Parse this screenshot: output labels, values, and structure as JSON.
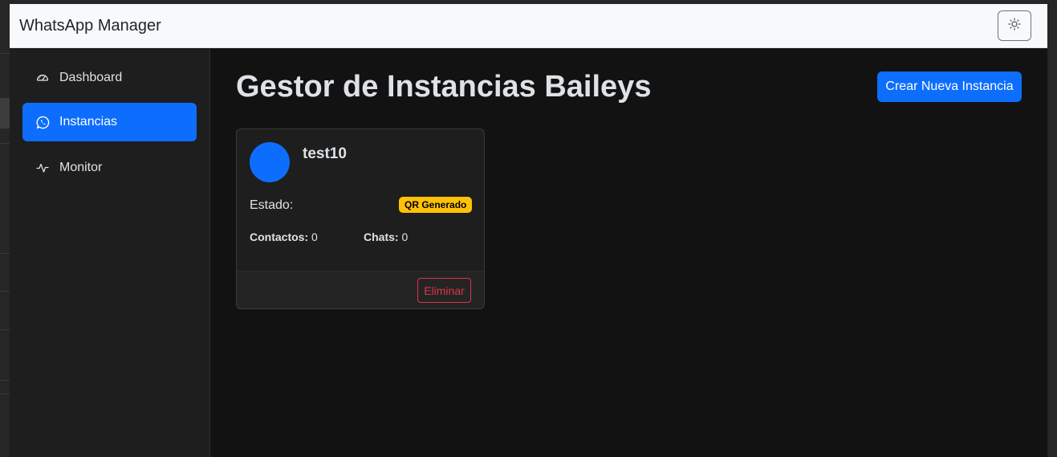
{
  "navbar": {
    "brand": "WhatsApp Manager",
    "theme_toggle_icon": "sun-icon"
  },
  "sidebar": {
    "items": [
      {
        "label": "Dashboard",
        "icon": "speedometer-icon",
        "active": false
      },
      {
        "label": "Instancias",
        "icon": "whatsapp-icon",
        "active": true
      },
      {
        "label": "Monitor",
        "icon": "activity-icon",
        "active": false
      }
    ]
  },
  "main": {
    "title": "Gestor de Instancias Baileys",
    "create_button": "Crear Nueva Instancia"
  },
  "instance_card": {
    "name": "test10",
    "subtitle": "",
    "estado_label": "Estado:",
    "status": "QR Generado",
    "contacts_label": "Contactos:",
    "contacts_value": "0",
    "chats_label": "Chats:",
    "chats_value": "0",
    "footer_text": "",
    "delete_button": "Eliminar"
  },
  "colors": {
    "primary": "#0d6efd",
    "warning": "#ffc107",
    "danger": "#dc3545",
    "background": "#121212",
    "sidebar": "#1e1e1e"
  }
}
